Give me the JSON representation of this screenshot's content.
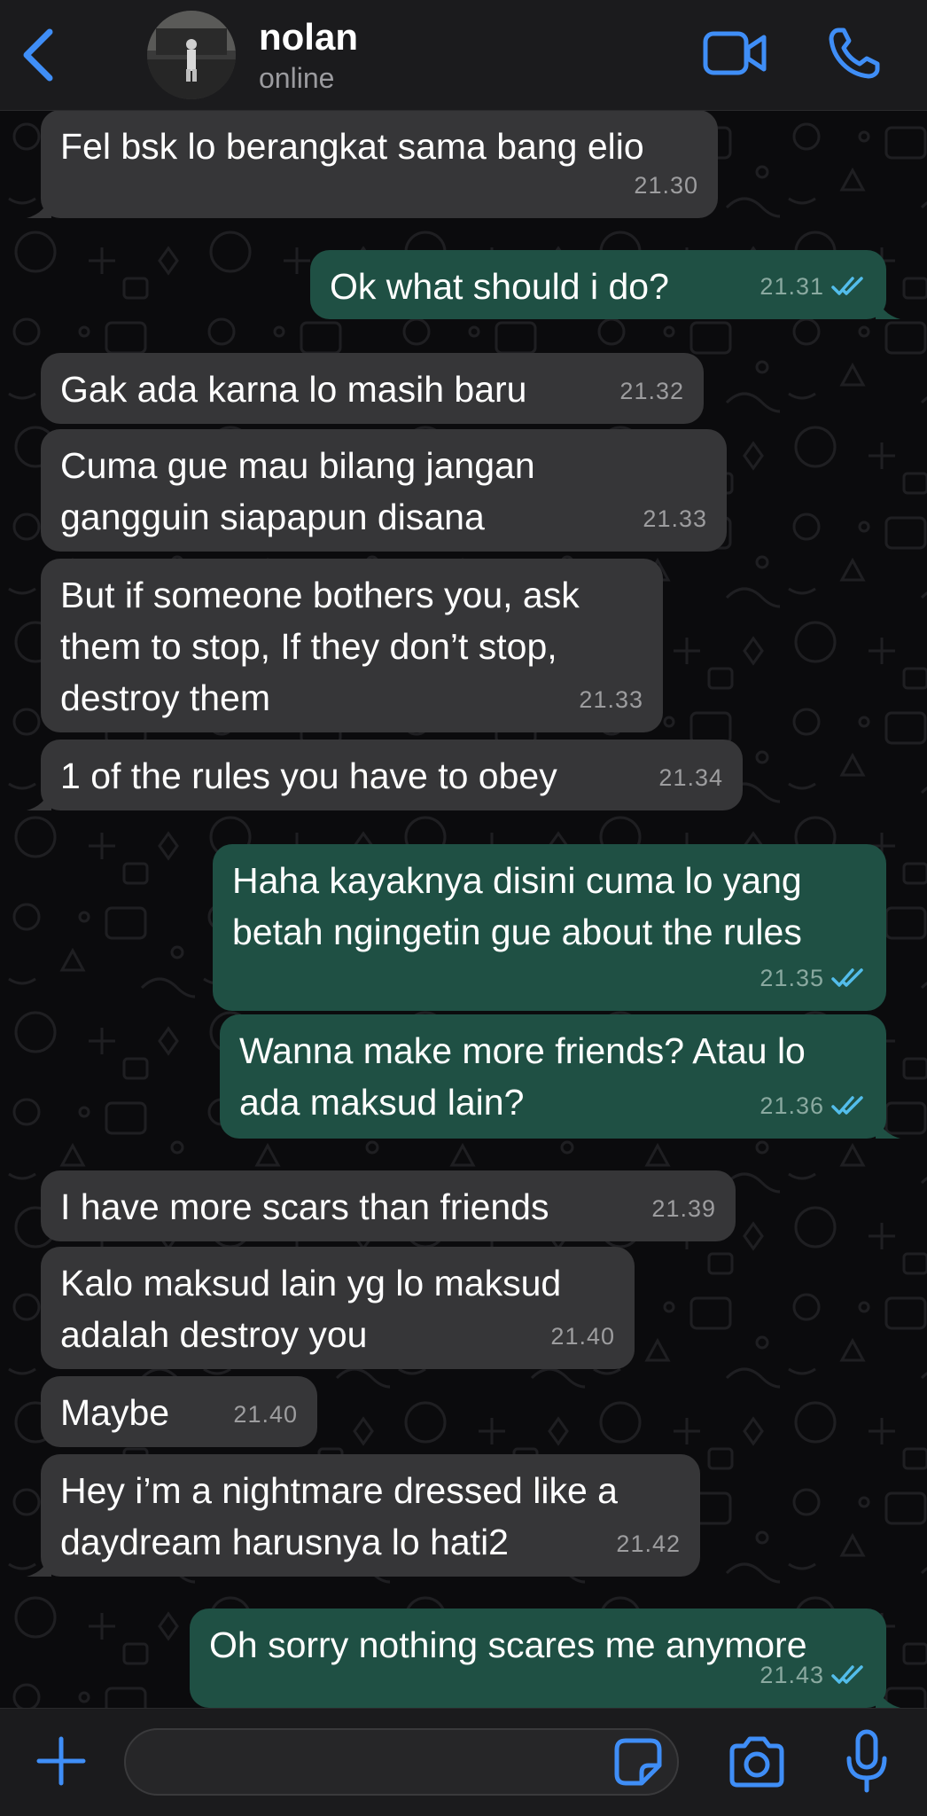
{
  "contact": {
    "name": "nolan",
    "status": "online"
  },
  "icons": {
    "back": "chevron-left-icon",
    "video": "video-camera-icon",
    "call": "phone-icon",
    "attach": "plus-icon",
    "sticker": "sticker-icon",
    "camera": "camera-icon",
    "mic": "microphone-icon"
  },
  "colors": {
    "accent": "#3f8ef7",
    "incoming_bubble": "#363638",
    "outgoing_bubble": "#1f5044",
    "read_ticks": "#53bdeb"
  },
  "messages": [
    {
      "dir": "in",
      "text": "Fel bsk lo berangkat sama bang elio",
      "time": "21.30"
    },
    {
      "dir": "out",
      "text": "Ok what should i do?",
      "time": "21.31",
      "read": true
    },
    {
      "dir": "in",
      "text": "Gak ada karna lo masih baru",
      "time": "21.32"
    },
    {
      "dir": "in",
      "text": "Cuma gue mau bilang jangan\ngangguin siapapun disana",
      "time": "21.33"
    },
    {
      "dir": "in",
      "text": "But if someone bothers you, ask\nthem to stop, If they don’t stop,\ndestroy them",
      "time": "21.33"
    },
    {
      "dir": "in",
      "text": "1 of the rules you have to obey",
      "time": "21.34"
    },
    {
      "dir": "out",
      "text": "Haha kayaknya disini cuma lo yang\nbetah ngingetin gue about the rules",
      "time": "21.35",
      "read": true
    },
    {
      "dir": "out",
      "text": "Wanna make more friends? Atau lo\nada maksud lain?",
      "time": "21.36",
      "read": true
    },
    {
      "dir": "in",
      "text": "I have more scars than friends",
      "time": "21.39"
    },
    {
      "dir": "in",
      "text": "Kalo maksud lain yg lo maksud\nadalah destroy you",
      "time": "21.40"
    },
    {
      "dir": "in",
      "text": "Maybe",
      "time": "21.40"
    },
    {
      "dir": "in",
      "text": "Hey i’m a nightmare dressed like a\ndaydream harusnya lo hati2",
      "time": "21.42"
    },
    {
      "dir": "out",
      "text": "Oh sorry nothing scares me anymore",
      "time": "21.43",
      "read": true
    }
  ],
  "composer": {
    "value": "",
    "placeholder": ""
  }
}
